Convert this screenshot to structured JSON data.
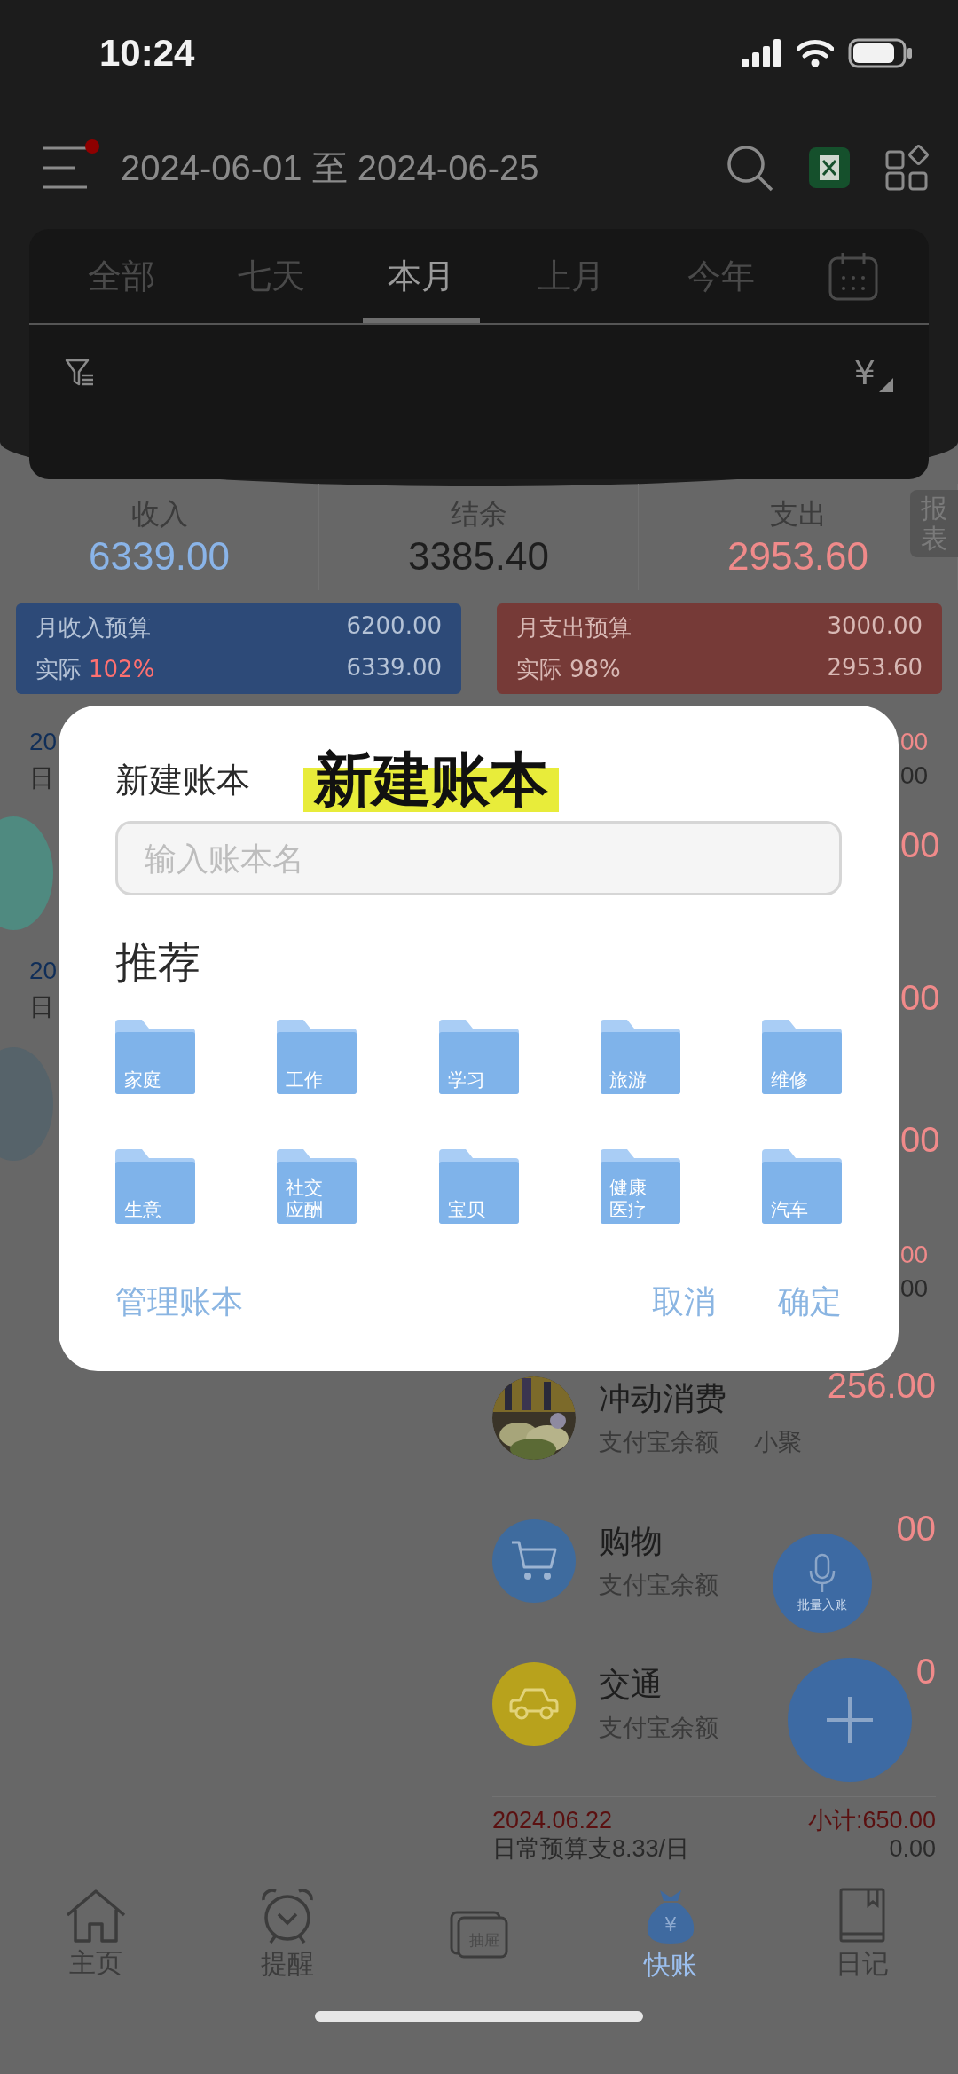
{
  "status_bar": {
    "time": "10:24"
  },
  "header": {
    "date_range": "2024-06-01 至 2024-06-25",
    "menu_badge": true
  },
  "period_tabs": [
    {
      "label": "全部",
      "selected": false
    },
    {
      "label": "七天",
      "selected": false
    },
    {
      "label": "本月",
      "selected": true
    },
    {
      "label": "上月",
      "selected": false
    },
    {
      "label": "今年",
      "selected": false
    }
  ],
  "filter_bar": {
    "currency": "¥"
  },
  "summary": [
    {
      "label": "收入",
      "value": "6339.00",
      "kind": "income"
    },
    {
      "label": "结余",
      "value": "3385.40",
      "kind": "balance"
    },
    {
      "label": "支出",
      "value": "2953.60",
      "kind": "expense"
    }
  ],
  "report_tab": "报表",
  "budgets": [
    {
      "kind": "income",
      "title": "月收入预算",
      "amount": "6200.00",
      "actual_label": "实际",
      "percent": "102%",
      "actual": "6339.00"
    },
    {
      "kind": "expense",
      "title": "月支出预算",
      "amount": "3000.00",
      "actual_label": "实际",
      "percent": "98%",
      "actual": "2953.60"
    }
  ],
  "left_list_peek": [
    {
      "kind": "date",
      "text": "20"
    },
    {
      "kind": "note",
      "text": "日"
    },
    {
      "kind": "avatar",
      "color": "#4f8a80"
    },
    {
      "kind": "date",
      "text": "20"
    },
    {
      "kind": "note",
      "text": "日"
    },
    {
      "kind": "avatar",
      "color": "#56636a"
    }
  ],
  "right_list_peek": [
    {
      "kind": "red",
      "text": "00"
    },
    {
      "kind": "gray",
      "text": "00"
    },
    {
      "kind": "big",
      "text": "00"
    },
    {
      "kind": "big",
      "text": "00"
    },
    {
      "kind": "big",
      "text": "00"
    },
    {
      "kind": "red",
      "text": "00"
    },
    {
      "kind": "gray",
      "text": "00"
    }
  ],
  "transactions": [
    {
      "kind": "picture",
      "category": "冲动消费",
      "account": "支付宝余额",
      "amount": "256.00",
      "note": "小聚"
    },
    {
      "kind": "shopping",
      "category": "购物",
      "account": "支付宝余额",
      "amount": "00"
    },
    {
      "kind": "transport",
      "category": "交通",
      "account": "支付宝余额",
      "amount": "0"
    }
  ],
  "day_summary": {
    "date": "2024.06.22",
    "subtotal": "小计:650.00",
    "budget_note": "日常预算支8.33/日",
    "amount": "0.00"
  },
  "voice_button": {
    "label": "批量入账"
  },
  "bottom_tabs": [
    {
      "kind": "home",
      "label": "主页",
      "selected": false
    },
    {
      "kind": "reminder",
      "label": "提醒",
      "selected": false
    },
    {
      "kind": "drawer",
      "icon_text": "抽屉",
      "selected": false
    },
    {
      "kind": "quick",
      "icon_text": "¥",
      "label": "快账",
      "selected": true
    },
    {
      "kind": "diary",
      "label": "日记",
      "selected": false
    }
  ],
  "dialog": {
    "title": "新建账本",
    "input": {
      "placeholder": "输入账本名"
    },
    "section_title": "推荐",
    "folders": [
      {
        "label": "家庭"
      },
      {
        "label": "工作"
      },
      {
        "label": "学习"
      },
      {
        "label": "旅游"
      },
      {
        "label": "维修"
      },
      {
        "label": "生意"
      },
      {
        "label": "社交应酬"
      },
      {
        "label": "宝贝"
      },
      {
        "label": "健康医疗"
      },
      {
        "label": "汽车"
      }
    ],
    "actions": [
      {
        "kind": "manage",
        "label": "管理账本"
      },
      {
        "kind": "cancel",
        "label": "取消"
      },
      {
        "kind": "confirm",
        "label": "确定"
      }
    ]
  },
  "overlay_caption": "新建账本"
}
